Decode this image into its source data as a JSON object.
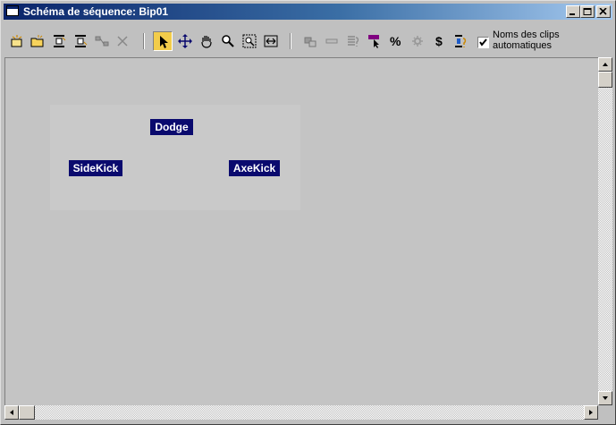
{
  "window": {
    "title": "Schéma de séquence: Bip01"
  },
  "toolbar": {
    "tools_left": [
      "create-clip-icon",
      "open-clip-icon",
      "insert-before-icon",
      "insert-after-icon",
      "connect-icon",
      "delete-icon"
    ],
    "tools_nav": [
      "select-icon",
      "move-icon",
      "pan-icon",
      "zoom-icon",
      "zoom-region-icon",
      "fit-width-icon"
    ],
    "tools_right": [
      "set-start-clip-icon",
      "minus-icon",
      "optimize-icon",
      "select-color-icon",
      "percent-icon",
      "gear-icon",
      "dollar-icon",
      "clip-info-icon"
    ],
    "auto_clip_names": {
      "label": "Noms des clips automatiques",
      "checked": true
    }
  },
  "clips": [
    {
      "name": "Dodge"
    },
    {
      "name": "SideKick"
    },
    {
      "name": "AxeKick"
    }
  ],
  "colors": {
    "titlebar_start": "#0a246a",
    "titlebar_end": "#a6caf0",
    "clip_bg": "#0a0a6e",
    "active_tool": "#f2cc4a"
  }
}
